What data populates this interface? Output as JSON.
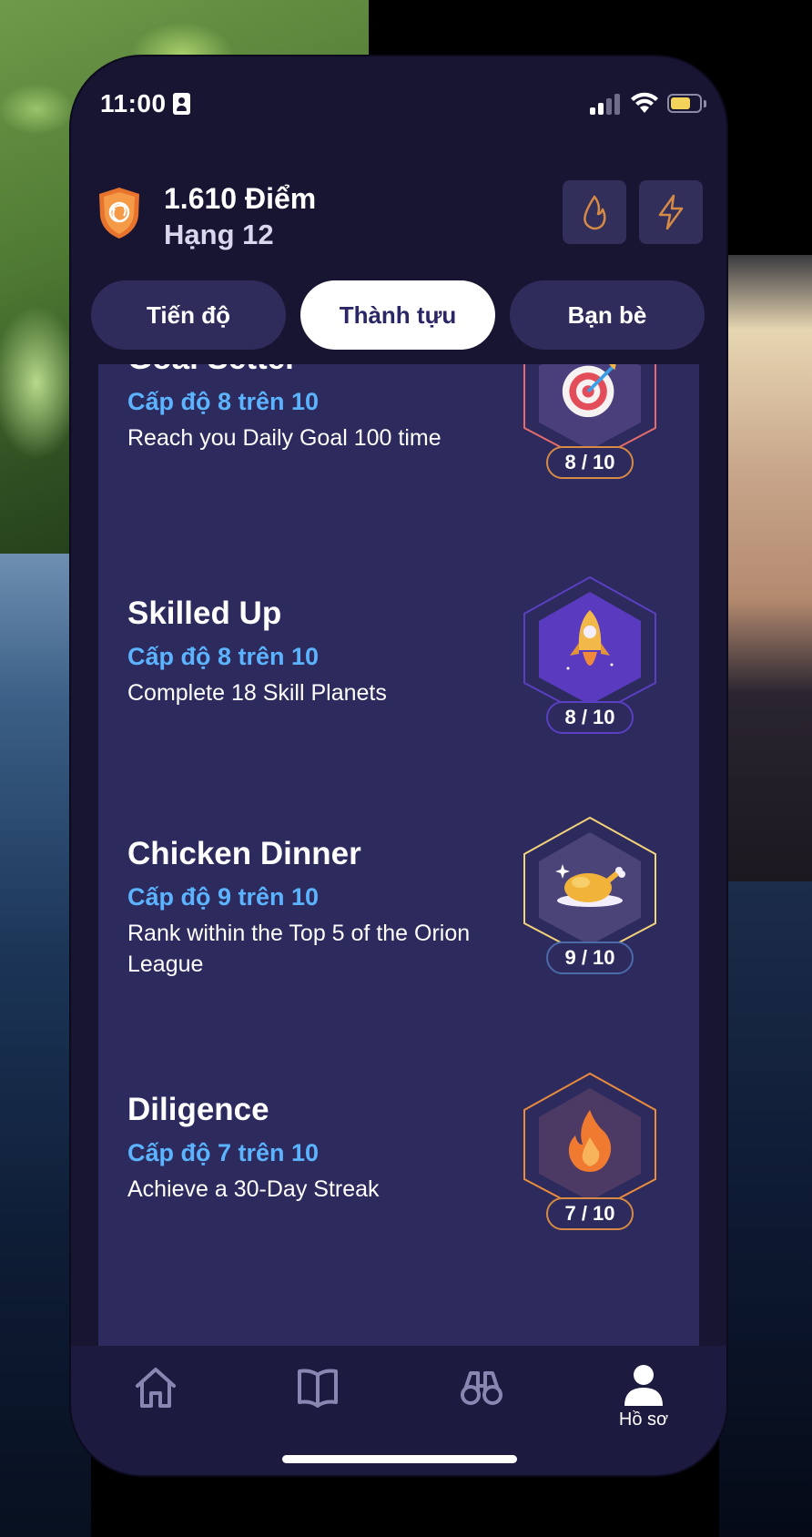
{
  "status_bar": {
    "time": "11:00",
    "id_icon": "person-card-icon",
    "signal_icon": "cellular-signal-icon",
    "wifi_icon": "wifi-icon",
    "battery_icon": "battery-icon",
    "battery_level": 0.7
  },
  "header": {
    "points": "1.610 Điểm",
    "rank": "Hạng 12",
    "shield_icon": "orange-shield-icon",
    "streak_icon": "flame-icon",
    "xp_icon": "lightning-icon"
  },
  "tabs": [
    {
      "label": "Tiến độ",
      "active": false
    },
    {
      "label": "Thành tựu",
      "active": true
    },
    {
      "label": "Bạn bè",
      "active": false
    }
  ],
  "achievements": [
    {
      "title": "Goal Setter",
      "level": "Cấp độ 8 trên 10",
      "description": "Reach you Daily Goal 100 time",
      "count": "8 / 10",
      "icon": "target-icon",
      "color": "#e36b6b"
    },
    {
      "title": "Skilled Up",
      "level": "Cấp độ 8 trên 10",
      "description": "Complete 18 Skill Planets",
      "count": "8 / 10",
      "icon": "rocket-icon",
      "color": "#6a3fd0"
    },
    {
      "title": "Chicken Dinner",
      "level": "Cấp độ 9 trên 10",
      "description": "Rank within the Top 5 of the Orion League",
      "count": "9 / 10",
      "icon": "roast-chicken-icon",
      "color": "#f2d27a"
    },
    {
      "title": "Diligence",
      "level": "Cấp độ 7 trên 10",
      "description": "Achieve a 30-Day Streak",
      "count": "7 / 10",
      "icon": "fire-icon",
      "color": "#e98c3e"
    }
  ],
  "tabbar": {
    "home_icon": "home-icon",
    "learn_icon": "open-book-icon",
    "explore_icon": "binoculars-icon",
    "profile_icon": "person-icon",
    "profile_label": "Hồ sơ"
  }
}
